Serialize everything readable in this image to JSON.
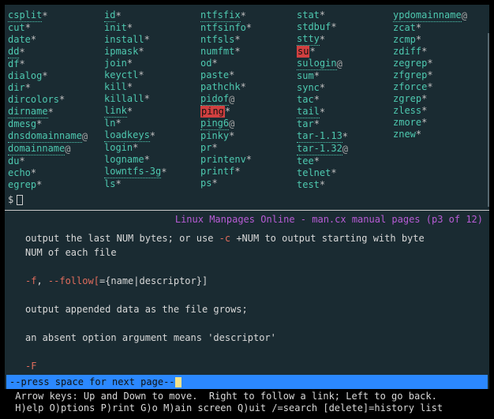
{
  "columns": [
    [
      {
        "name": "csplit",
        "mark": "*",
        "dotted": true
      },
      {
        "name": "cut",
        "mark": "*"
      },
      {
        "name": "date",
        "mark": "*"
      },
      {
        "name": "dd",
        "mark": "*",
        "dotted": true
      },
      {
        "name": "df",
        "mark": "*"
      },
      {
        "name": "dialog",
        "mark": "*"
      },
      {
        "name": "dir",
        "mark": "*"
      },
      {
        "name": "dircolors",
        "mark": "*"
      },
      {
        "name": "dirname",
        "mark": "*",
        "dotted": true
      },
      {
        "name": "dmesg",
        "mark": "*"
      },
      {
        "name": "dnsdomainname",
        "mark": "@",
        "dotted": true
      },
      {
        "name": "domainname",
        "mark": "@",
        "dotted": true
      },
      {
        "name": "du",
        "mark": "*"
      },
      {
        "name": "echo",
        "mark": "*"
      },
      {
        "name": "egrep",
        "mark": "*"
      }
    ],
    [
      {
        "name": "id",
        "mark": "*",
        "dotted": true
      },
      {
        "name": "init",
        "mark": "*"
      },
      {
        "name": "install",
        "mark": "*"
      },
      {
        "name": "ipmask",
        "mark": "*"
      },
      {
        "name": "join",
        "mark": "*"
      },
      {
        "name": "keyctl",
        "mark": "*"
      },
      {
        "name": "kill",
        "mark": "*"
      },
      {
        "name": "killall",
        "mark": "*"
      },
      {
        "name": "link",
        "mark": "*",
        "dotted": true
      },
      {
        "name": "ln",
        "mark": "*"
      },
      {
        "name": "loadkeys",
        "mark": "*",
        "dotted": true
      },
      {
        "name": "login",
        "mark": "*"
      },
      {
        "name": "logname",
        "mark": "*"
      },
      {
        "name": "lowntfs-3g",
        "mark": "*",
        "dotted": true
      },
      {
        "name": "ls",
        "mark": "*"
      }
    ],
    [
      {
        "name": "ntfsfix",
        "mark": "*",
        "dotted": true
      },
      {
        "name": "ntfsinfo",
        "mark": "*"
      },
      {
        "name": "ntfsls",
        "mark": "*"
      },
      {
        "name": "numfmt",
        "mark": "*"
      },
      {
        "name": "od",
        "mark": "*"
      },
      {
        "name": "paste",
        "mark": "*"
      },
      {
        "name": "pathchk",
        "mark": "*"
      },
      {
        "name": "pidof",
        "mark": "@",
        "dotted": true
      },
      {
        "name": "ping",
        "mark": "*",
        "dotted": true,
        "highlight": true
      },
      {
        "name": "ping6",
        "mark": "@",
        "dotted": true
      },
      {
        "name": "pinky",
        "mark": "*"
      },
      {
        "name": "pr",
        "mark": "*"
      },
      {
        "name": "printenv",
        "mark": "*"
      },
      {
        "name": "printf",
        "mark": "*"
      },
      {
        "name": "ps",
        "mark": "*"
      }
    ],
    [
      {
        "name": "stat",
        "mark": "*"
      },
      {
        "name": "stdbuf",
        "mark": "*"
      },
      {
        "name": "stty",
        "mark": "*",
        "dotted": true
      },
      {
        "name": "su",
        "mark": "*",
        "dotted": true,
        "highlight": true
      },
      {
        "name": "sulogin",
        "mark": "@",
        "dotted": true
      },
      {
        "name": "sum",
        "mark": "*"
      },
      {
        "name": "sync",
        "mark": "*"
      },
      {
        "name": "tac",
        "mark": "*"
      },
      {
        "name": "tail",
        "mark": "*",
        "dotted": true
      },
      {
        "name": "tar",
        "mark": "*"
      },
      {
        "name": "tar-1.13",
        "mark": "*",
        "dotted": true
      },
      {
        "name": "tar-1.32",
        "mark": "@",
        "dotted": true
      },
      {
        "name": "tee",
        "mark": "*"
      },
      {
        "name": "telnet",
        "mark": "*"
      },
      {
        "name": "test",
        "mark": "*"
      }
    ],
    [
      {
        "name": "ypdomainname",
        "mark": "@",
        "dotted": true
      },
      {
        "name": "zcat",
        "mark": "*"
      },
      {
        "name": "zcmp",
        "mark": "*"
      },
      {
        "name": "zdiff",
        "mark": "*"
      },
      {
        "name": "zegrep",
        "mark": "*"
      },
      {
        "name": "zfgrep",
        "mark": "*"
      },
      {
        "name": "zforce",
        "mark": "*"
      },
      {
        "name": "zgrep",
        "mark": "*"
      },
      {
        "name": "zless",
        "mark": "*"
      },
      {
        "name": "zmore",
        "mark": "*"
      },
      {
        "name": "znew",
        "mark": "*"
      }
    ]
  ],
  "prompt_symbol": "$",
  "pager_title": "Linux Manpages Online - man.cx manual pages (p3 of 12)",
  "pager_body": {
    "line1_a": "output the last NUM bytes; or use ",
    "line1_opt": "-c",
    "line1_b": " +NUM to output starting with byte",
    "line2": "NUM of each file",
    "line3_opt_f": "-f",
    "line3_sep": ", ",
    "line3_opt_follow": "--follow[",
    "line3_rest": "={name|descriptor}]",
    "line4": "output appended data as the file grows;",
    "line5": "an absent option argument means 'descriptor'",
    "line6_opt": "-F"
  },
  "status_bar": {
    "prefix": "-- ",
    "text": "press space for next page",
    "suffix": " --"
  },
  "help_lines": [
    " Arrow keys: Up and Down to move.  Right to follow a link; Left to go back.",
    " H)elp O)ptions P)rint G)o M)ain screen Q)uit /=search [delete]=history list"
  ]
}
